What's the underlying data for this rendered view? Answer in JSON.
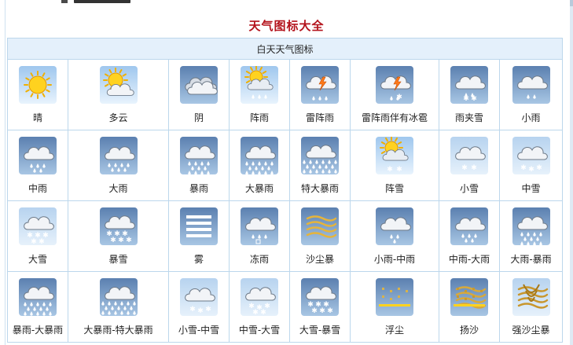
{
  "page": {
    "title": "天气图标大全"
  },
  "table": {
    "header": "白天天气图标",
    "rows": [
      [
        {
          "label": "晴",
          "icon": "sunny-icon"
        },
        {
          "label": "多云",
          "icon": "partly-cloudy-icon"
        },
        {
          "label": "阴",
          "icon": "overcast-icon"
        },
        {
          "label": "阵雨",
          "icon": "shower-icon"
        },
        {
          "label": "雷阵雨",
          "icon": "thunder-shower-icon"
        },
        {
          "label": "雷阵雨伴有冰雹",
          "icon": "thunder-hail-icon"
        },
        {
          "label": "雨夹雪",
          "icon": "sleet-icon"
        },
        {
          "label": "小雨",
          "icon": "light-rain-icon"
        }
      ],
      [
        {
          "label": "中雨",
          "icon": "moderate-rain-icon"
        },
        {
          "label": "大雨",
          "icon": "heavy-rain-icon"
        },
        {
          "label": "暴雨",
          "icon": "rainstorm-icon"
        },
        {
          "label": "大暴雨",
          "icon": "heavy-rainstorm-icon"
        },
        {
          "label": "特大暴雨",
          "icon": "extreme-rainstorm-icon"
        },
        {
          "label": "阵雪",
          "icon": "snow-shower-icon"
        },
        {
          "label": "小雪",
          "icon": "light-snow-icon"
        },
        {
          "label": "中雪",
          "icon": "moderate-snow-icon"
        }
      ],
      [
        {
          "label": "大雪",
          "icon": "heavy-snow-icon"
        },
        {
          "label": "暴雪",
          "icon": "blizzard-icon"
        },
        {
          "label": "雾",
          "icon": "fog-icon"
        },
        {
          "label": "冻雨",
          "icon": "freezing-rain-icon"
        },
        {
          "label": "沙尘暴",
          "icon": "sandstorm-icon"
        },
        {
          "label": "小雨-中雨",
          "icon": "light-to-moderate-rain-icon"
        },
        {
          "label": "中雨-大雨",
          "icon": "moderate-to-heavy-rain-icon"
        },
        {
          "label": "大雨-暴雨",
          "icon": "heavy-rain-to-rainstorm-icon"
        }
      ],
      [
        {
          "label": "暴雨-大暴雨",
          "icon": "rainstorm-to-heavy-rainstorm-icon"
        },
        {
          "label": "大暴雨-特大暴雨",
          "icon": "heavy-to-extreme-rainstorm-icon"
        },
        {
          "label": "小雪-中雪",
          "icon": "light-to-moderate-snow-icon"
        },
        {
          "label": "中雪-大雪",
          "icon": "moderate-to-heavy-snow-icon"
        },
        {
          "label": "大雪-暴雪",
          "icon": "heavy-snow-to-blizzard-icon"
        },
        {
          "label": "浮尘",
          "icon": "floating-dust-icon"
        },
        {
          "label": "扬沙",
          "icon": "blowing-sand-icon"
        },
        {
          "label": "强沙尘暴",
          "icon": "severe-sandstorm-icon"
        }
      ]
    ]
  }
}
